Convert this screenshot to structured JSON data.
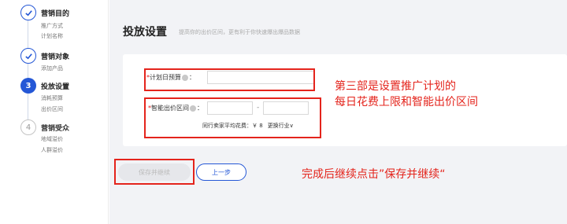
{
  "sidebar": {
    "steps": [
      {
        "title": "营销目的",
        "subs": [
          "推广方式",
          "计划名称"
        ],
        "state": "done"
      },
      {
        "title": "营销对象",
        "subs": [
          "添加产品"
        ],
        "state": "done"
      },
      {
        "title": "投放设置",
        "subs": [
          "消耗预算",
          "出价区间"
        ],
        "state": "active",
        "number": "3"
      },
      {
        "title": "营销受众",
        "subs": [
          "地域溢价",
          "人群溢价"
        ],
        "state": "todo",
        "number": "4"
      }
    ]
  },
  "main": {
    "title": "投放设置",
    "hint": "提高你的出价区间，更有利于你快速爆出爆品数据",
    "daily_budget_label": "计划日预算",
    "smart_bid_label": "智能出价区间",
    "colon": "：",
    "range_dash": "-",
    "avg_cost_text": "同行卖家平均花费：￥ 8",
    "change_industry": "更换行业∨"
  },
  "annotations": {
    "note_budget_line1": "第三部是设置推广计划的",
    "note_budget_line2": "每日花费上限和智能出价区间",
    "note_save": "完成后继续点击”保存并继续“"
  },
  "buttons": {
    "save_continue": "保存并继续",
    "prev_step": "上一步"
  },
  "colors": {
    "accent": "#2457d6",
    "annotation_red": "#e4241c",
    "required_red": "#e02020"
  }
}
